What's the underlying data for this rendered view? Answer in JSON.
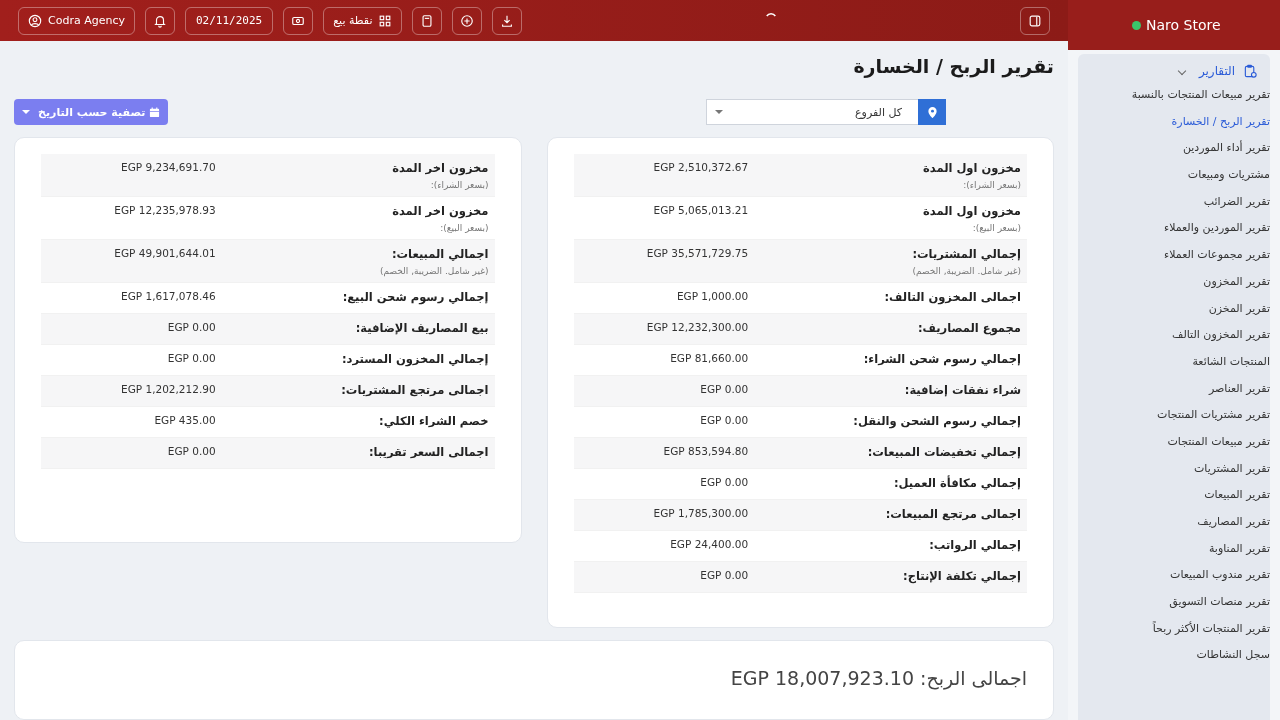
{
  "topbar": {
    "user": "Codra Agency",
    "date": "02/11/2025",
    "pos_label": "نقطة بيع"
  },
  "sidebar": {
    "brand": "Naro Store",
    "group": {
      "label": "التقارير",
      "expanded": true,
      "items": [
        {
          "label": "تقرير مبيعات المنتجات بالنسبة",
          "selected": false
        },
        {
          "label": "تقرير الربح / الخسارة",
          "selected": true
        },
        {
          "label": "تقرير أداء الموردين",
          "selected": false
        },
        {
          "label": "مشتريات ومبيعات",
          "selected": false
        },
        {
          "label": "تقرير الضرائب",
          "selected": false
        },
        {
          "label": "تقرير الموردين والعملاء",
          "selected": false
        },
        {
          "label": "تقرير مجموعات العملاء",
          "selected": false
        },
        {
          "label": "تقرير المخزون",
          "selected": false
        },
        {
          "label": "تقرير المخزن",
          "selected": false
        },
        {
          "label": "تقرير المخزون التالف",
          "selected": false
        },
        {
          "label": "المنتجات الشائعة",
          "selected": false
        },
        {
          "label": "تقرير العناصر",
          "selected": false
        },
        {
          "label": "تقرير مشتريات المنتجات",
          "selected": false
        },
        {
          "label": "تقرير مبيعات المنتجات",
          "selected": false
        },
        {
          "label": "تقرير المشتريات",
          "selected": false
        },
        {
          "label": "تقرير المبيعات",
          "selected": false
        },
        {
          "label": "تقرير المصاريف",
          "selected": false
        },
        {
          "label": "تقرير المناوبة",
          "selected": false
        },
        {
          "label": "تقرير مندوب المبيعات",
          "selected": false
        },
        {
          "label": "تقرير منصات التسويق",
          "selected": false
        },
        {
          "label": "تقرير المنتجات الأكثر ربحاً",
          "selected": false
        },
        {
          "label": "سجل النشاطات",
          "selected": false
        }
      ]
    }
  },
  "page": {
    "title": "تقرير الربح / الخسارة",
    "filters": {
      "date_button": "تصفية حسب التاريخ",
      "branch": "كل الفروع"
    }
  },
  "cards": [
    {
      "rows": [
        {
          "label": "مخزون اول المدة",
          "note": "(بسعر الشراء):",
          "value": "EGP 2,510,372.67"
        },
        {
          "label": "مخزون اول المدة",
          "note": "(بسعر البيع):",
          "value": "EGP 5,065,013.21"
        },
        {
          "label": "إجمالي المشتريات:",
          "note": "(غير شامل. الضريبة, الخصم)",
          "value": "EGP 35,571,729.75"
        },
        {
          "label": "اجمالى المخزون التالف:",
          "value": "EGP 1,000.00"
        },
        {
          "label": "مجموع المصاريف:",
          "value": "EGP 12,232,300.00"
        },
        {
          "label": "إجمالي رسوم شحن الشراء:",
          "value": "EGP 81,660.00"
        },
        {
          "label": "شراء نفقات إضافية:",
          "value": "EGP 0.00"
        },
        {
          "label": "إجمالي رسوم الشحن والنقل:",
          "value": "EGP 0.00"
        },
        {
          "label": "إجمالي تخفيضات المبيعات:",
          "value": "EGP 853,594.80"
        },
        {
          "label": "إجمالي مكافأة العميل:",
          "value": "EGP 0.00"
        },
        {
          "label": "اجمالى مرتجع المبيعات:",
          "value": "EGP 1,785,300.00"
        },
        {
          "label": "إجمالي الرواتب:",
          "value": "EGP 24,400.00"
        },
        {
          "label": "إجمالي تكلفة الإنتاج:",
          "value": "EGP 0.00"
        }
      ]
    },
    {
      "rows": [
        {
          "label": "مخزون اخر المدة",
          "note": "(بسعر الشراء):",
          "value": "EGP 9,234,691.70"
        },
        {
          "label": "مخزون اخر المدة",
          "note": "(بسعر البيع):",
          "value": "EGP 12,235,978.93"
        },
        {
          "label": "اجمالي المبيعات:",
          "note": "(غير شامل. الضريبة, الخصم)",
          "value": "EGP 49,901,644.01"
        },
        {
          "label": "إجمالي رسوم شحن البيع:",
          "value": "EGP 1,617,078.46"
        },
        {
          "label": "بيع المصاريف الإضافية:",
          "value": "EGP 0.00"
        },
        {
          "label": "إجمالي المخزون المسترد:",
          "value": "EGP 0.00"
        },
        {
          "label": "اجمالى مرتجع المشتريات:",
          "value": "EGP 1,202,212.90"
        },
        {
          "label": "خصم الشراء الكلي:",
          "value": "EGP 435.00"
        },
        {
          "label": "اجمالى السعر تقريبا:",
          "value": "EGP 0.00"
        }
      ]
    }
  ],
  "total": {
    "text": "اجمالى الربح: EGP 18,007,923.10"
  }
}
